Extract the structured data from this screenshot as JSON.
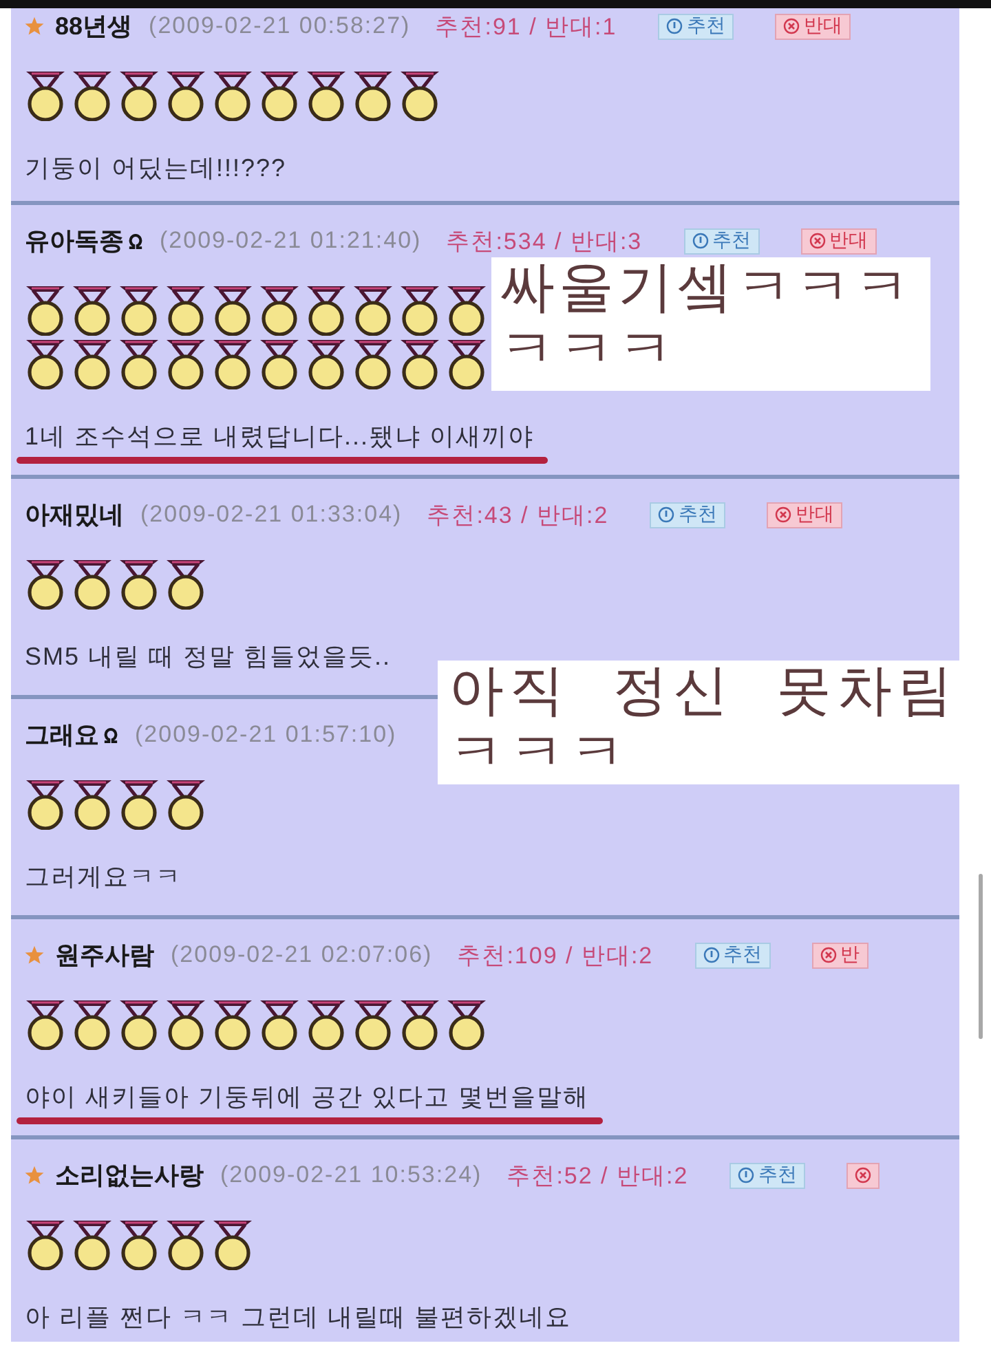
{
  "comments": [
    {
      "starred": true,
      "name": "88년생",
      "badge": false,
      "date": "(2009-02-21 00:58:27)",
      "votes": "추천:91 / 반대:1",
      "buttons": [
        {
          "kind": "recommend",
          "label": "추천"
        },
        {
          "kind": "oppose",
          "label": "반대"
        }
      ],
      "medal_rows": [
        {
          "stars": 9
        }
      ],
      "text": "기둥이 어딨는데!!!???",
      "underlined": false
    },
    {
      "starred": false,
      "name": "유아독종",
      "badge": true,
      "date": "(2009-02-21 01:21:40)",
      "votes": "추천:534 / 반대:3",
      "buttons": [
        {
          "kind": "recommend",
          "label": "추천"
        },
        {
          "kind": "oppose",
          "label": "반대"
        }
      ],
      "medal_rows": [
        {
          "stars": 10
        },
        {
          "stars": 10
        }
      ],
      "text": "1네 조수석으로 내렸답니다...됐냐 이새끼야",
      "underlined": true
    },
    {
      "starred": false,
      "name": "아재밌네",
      "badge": false,
      "date": "(2009-02-21 01:33:04)",
      "votes": "추천:43 / 반대:2",
      "buttons": [
        {
          "kind": "recommend",
          "label": "추천"
        },
        {
          "kind": "oppose",
          "label": "반대"
        }
      ],
      "medal_rows": [
        {
          "stars": 4
        }
      ],
      "text": "SM5 내릴 때 정말 힘들었을듯..",
      "underlined": false
    },
    {
      "starred": false,
      "name": "그래요",
      "badge": true,
      "date": "(2009-02-21 01:57:10)",
      "medal_rows": [
        {
          "stars": 4
        }
      ],
      "text": "그러게요ㅋㅋ",
      "underlined": false
    },
    {
      "starred": true,
      "name": "원주사람",
      "badge": false,
      "date": "(2009-02-21 02:07:06)",
      "votes": "추천:109 / 반대:2",
      "buttons": [
        {
          "kind": "recommend",
          "label": "추천"
        },
        {
          "kind": "oppose",
          "label": "반"
        }
      ],
      "medal_rows": [
        {
          "stars": 10
        }
      ],
      "text": "야이 새키들아 기둥뒤에 공간 있다고 몇번을말해",
      "underlined": true
    },
    {
      "starred": true,
      "name": "소리없는사랑",
      "badge": false,
      "date": "(2009-02-21 10:53:24)",
      "votes": "추천:52 / 반대:2",
      "buttons": [
        {
          "kind": "recommend",
          "label": "추천"
        },
        {
          "kind": "oppose"
        }
      ],
      "medal_rows": [
        {
          "stars": 5
        }
      ],
      "text": "아 리플 쩐다 ㅋㅋ 그런데 내릴때 불편하겠네요",
      "underlined": false
    }
  ],
  "captions": [
    {
      "lines": [
        "싸울기셐ㅋㅋㅋ",
        "ㅋㅋㅋ"
      ]
    },
    {
      "lines": [
        "아직 정신 못차림",
        "ㅋㅋㅋ"
      ]
    }
  ]
}
